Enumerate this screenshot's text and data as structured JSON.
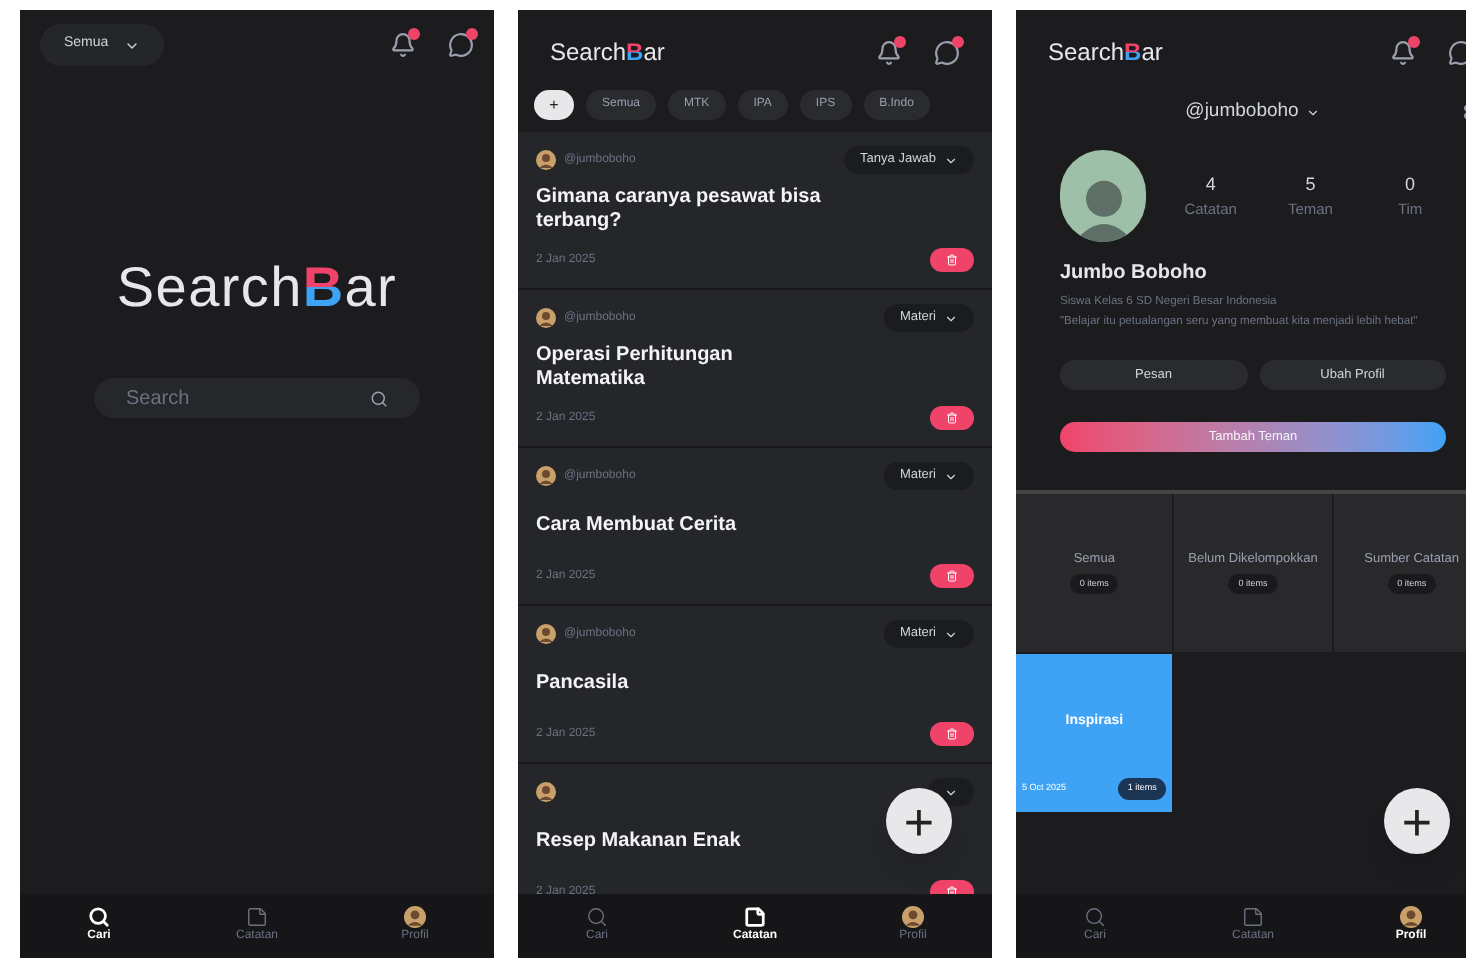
{
  "search_screen": {
    "filter": {
      "label": "Semua"
    },
    "logo": {
      "prefix": "Search",
      "accent": "B",
      "suffix": "ar"
    },
    "search": {
      "placeholder": "Search"
    },
    "nav": [
      {
        "label": "Cari",
        "selected": true
      },
      {
        "label": "Catatan",
        "selected": false
      },
      {
        "label": "Profil",
        "selected": false
      }
    ]
  },
  "notes_screen": {
    "logo": {
      "prefix": "Search",
      "accent": "B",
      "suffix": "ar"
    },
    "add_chip": "+",
    "chips": [
      {
        "label": "Semua",
        "selected": false
      },
      {
        "label": "MTK",
        "selected": false
      },
      {
        "label": "IPA",
        "selected": false
      },
      {
        "label": "IPS",
        "selected": false
      },
      {
        "label": "B.Indo",
        "selected": false
      }
    ],
    "notes": [
      {
        "author": "@jumboboho",
        "category": "Tanya Jawab",
        "title": "Gimana caranya pesawat bisa terbang?",
        "date": "2 Jan 2025"
      },
      {
        "author": "@jumboboho",
        "category": "Materi",
        "title": "Operasi Perhitungan Matematika",
        "date": "2 Jan 2025"
      },
      {
        "author": "@jumboboho",
        "category": "Materi",
        "title": "Cara Membuat Cerita",
        "date": "2 Jan 2025"
      },
      {
        "author": "@jumboboho",
        "category": "Materi",
        "title": "Pancasila",
        "date": "2 Jan 2025"
      },
      {
        "title": "Resep Makanan Enak",
        "date": "2 Jan 2025"
      }
    ],
    "fab": "+",
    "nav": [
      {
        "label": "Cari",
        "selected": false
      },
      {
        "label": "Catatan",
        "selected": true
      },
      {
        "label": "Profil",
        "selected": false
      }
    ]
  },
  "profile_screen": {
    "logo": {
      "prefix": "Search",
      "accent": "B",
      "suffix": "ar"
    },
    "handle": "@jumboboho",
    "stats": [
      {
        "value": "4",
        "label": "Catatan"
      },
      {
        "value": "5",
        "label": "Teman"
      },
      {
        "value": "0",
        "label": "Tim"
      }
    ],
    "name": "Jumbo Boboho",
    "bio": "Siswa Kelas 6 SD Negeri Besar Indonesia",
    "quote": "\"Belajar itu petualangan seru yang membuat kita menjadi lebih hebat\"",
    "buttons": [
      "Pesan",
      "Ubah Profil"
    ],
    "add_friend": "Tambah Teman",
    "folders": [
      {
        "kind": "plain",
        "title": "Semua",
        "count": "0 items"
      },
      {
        "kind": "plain",
        "title": "Belum Dikelompokkan",
        "count": "0 items"
      },
      {
        "kind": "plain",
        "title": "Sumber Catatan",
        "count": "0 items"
      },
      {
        "kind": "highlight",
        "title": "Inspirasi",
        "count": "1 items",
        "date": "5 Oct 2025"
      }
    ],
    "fab": "+",
    "nav": [
      {
        "label": "Cari",
        "selected": false
      },
      {
        "label": "Catatan",
        "selected": false
      },
      {
        "label": "Profil",
        "selected": true
      }
    ]
  }
}
